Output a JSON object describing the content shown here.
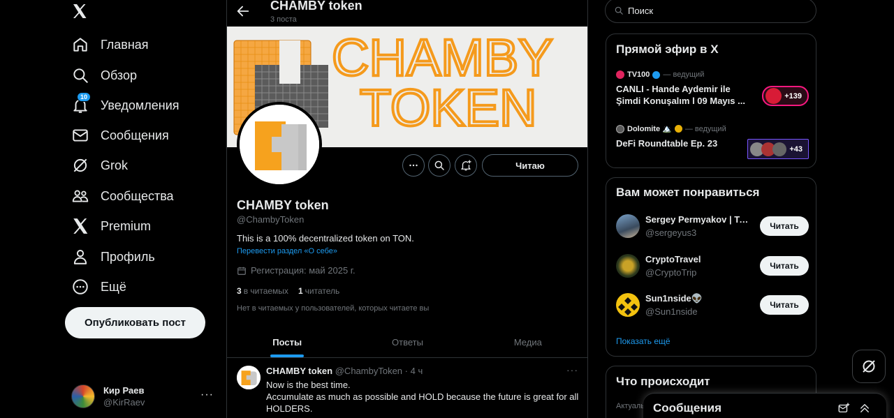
{
  "nav": {
    "logo_icon": "x-logo-icon",
    "items": [
      {
        "label": "Главная",
        "icon": "home-icon"
      },
      {
        "label": "Обзор",
        "icon": "search-icon"
      },
      {
        "label": "Уведомления",
        "icon": "bell-icon",
        "badge": "10"
      },
      {
        "label": "Сообщения",
        "icon": "mail-icon"
      },
      {
        "label": "Grok",
        "icon": "grok-icon"
      },
      {
        "label": "Сообщества",
        "icon": "communities-icon"
      },
      {
        "label": "Premium",
        "icon": "x-logo-icon"
      },
      {
        "label": "Профиль",
        "icon": "person-icon"
      },
      {
        "label": "Ещё",
        "icon": "more-circle-icon"
      }
    ],
    "post_button": "Опубликовать пост",
    "account": {
      "name": "Кир Раев",
      "handle": "@KirRaev",
      "more": "···"
    }
  },
  "header": {
    "title": "CHAMBY token",
    "subtitle": "3 поста"
  },
  "banner": {
    "line1": "CHAMBY",
    "line2": "TOKEN"
  },
  "profile": {
    "name": "CHAMBY token",
    "handle": "@ChambyToken",
    "bio": "This is a 100% decentralized token on TON.",
    "translate": "Перевести раздел «О себе»",
    "joined": "Регистрация: май 2025 г.",
    "following_count": "3",
    "following_label": "в читаемых",
    "followers_count": "1",
    "followers_label": "читатель",
    "mutual_note": "Нет в читаемых у пользователей, которых читаете вы",
    "follow_button": "Читаю"
  },
  "tabs": [
    "Посты",
    "Ответы",
    "Медиа"
  ],
  "tweet": {
    "name": "CHAMBY token",
    "handle": "@ChambyToken",
    "time": "· 4 ч",
    "more": "···",
    "lines": [
      "Now is the best time.",
      "Accumulate as much as possible and HOLD because the future is great for all HOLDERS."
    ]
  },
  "search": {
    "placeholder": "Поиск"
  },
  "live": {
    "title": "Прямой эфир в X",
    "items": [
      {
        "host": "TV100",
        "role": "— ведущий",
        "title": "CANLI - Hande Aydemir ile Şimdi Konuşalım l 09 Mayıs ...",
        "count": "+139",
        "accent": "#f91880"
      },
      {
        "host": "Dolomite 🏔️",
        "role": "— ведущий",
        "title": "DeFi Roundtable Ep. 23",
        "count": "+43",
        "accent": "#7856ff"
      }
    ]
  },
  "suggestions": {
    "title": "Вам может понравиться",
    "items": [
      {
        "name": "Sergey Permyakov | Ta...",
        "handle": "@sergeyus3",
        "button": "Читать"
      },
      {
        "name": "CryptoTravel",
        "handle": "@CryptoTrip",
        "button": "Читать"
      },
      {
        "name": "Sun1nside👽",
        "handle": "@Sun1nside",
        "button": "Читать"
      }
    ],
    "show_more": "Показать ещё"
  },
  "trends": {
    "title": "Что происходит",
    "label": "Актуаль"
  },
  "messages_drawer": {
    "title": "Сообщения"
  },
  "colors": {
    "accent": "#1d9bf0",
    "background": "#000000",
    "text": "#e7e9ea",
    "muted": "#71767b",
    "banner_orange": "#f59a1c"
  }
}
